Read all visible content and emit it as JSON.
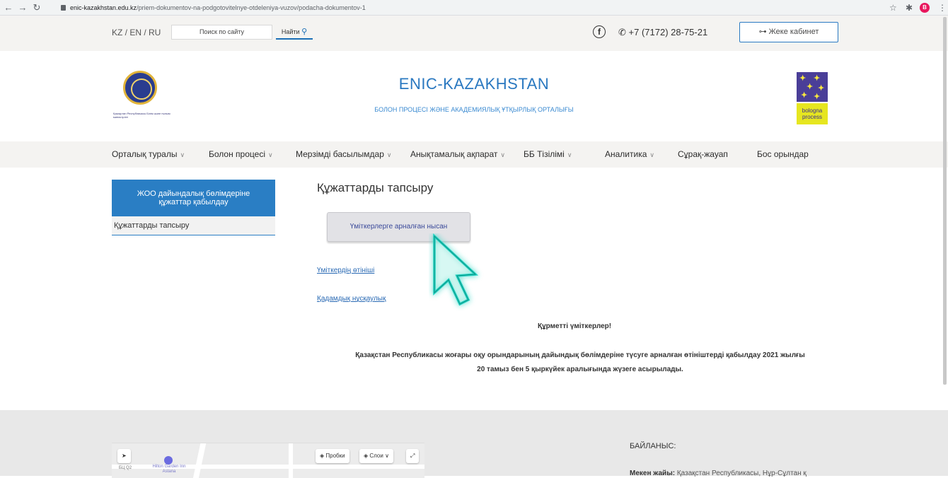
{
  "browser": {
    "url_host": "enic-kazakhstan.edu.kz",
    "url_path": "/priem-dokumentov-na-podgotovitelnye-otdeleniya-vuzov/podacha-dokumentov-1",
    "profile_initial": "B"
  },
  "topbar": {
    "languages": "KZ / EN / RU",
    "search_placeholder": "Поиск по сайту",
    "search_button": "Найти",
    "phone": "+7 (7172) 28-75-21",
    "cabinet_button": "Жеке кабинет"
  },
  "header": {
    "title": "ENIC-KAZAKHSTAN",
    "subtitle": "БОЛОН ПРОЦЕСІ ЖӘНЕ АКАДЕМИЯЛЫҚ ҰТҚЫРЛЫҚ ОРТАЛЫҒЫ",
    "logo_caption": "Қазақстан Республикасы Білім және ғылым министрлігі",
    "bologna_text_1": "bologna",
    "bologna_text_2": "process"
  },
  "nav": {
    "items": [
      {
        "label": "Орталық туралы",
        "dropdown": true
      },
      {
        "label": "Болон процесі",
        "dropdown": true
      },
      {
        "label": "Мерзімді басылымдар",
        "dropdown": true
      },
      {
        "label": "Анықтамалық ақпарат",
        "dropdown": true
      },
      {
        "label": "ББ Тізілімі",
        "dropdown": true
      },
      {
        "label": "Аналитика",
        "dropdown": true
      },
      {
        "label": "Сұрақ-жауап",
        "dropdown": false
      },
      {
        "label": "Бос орындар",
        "dropdown": false
      }
    ]
  },
  "sidebar": {
    "active_section": "ЖОО дайындалық бөлімдеріне құжаттар қабылдау",
    "items": [
      "Құжаттарды тапсыру"
    ]
  },
  "content": {
    "title": "Құжаттарды тапсыру",
    "form_button": "Үміткерлерге арналған нысан",
    "link_application": "Үміткердің өтініші",
    "link_guide": "Қадамдық нұсқаулық",
    "greeting": "Құрметті үміткерлер!",
    "notice_line1": "Қазақстан Республикасы жоғары оқу орындарының дайындық бөлімдеріне түсуге арналған өтініштерді қабылдау 2021 жылғы",
    "notice_line2": "20 тамыз бен 5 қыркүйек аралығында жүзеге асырылады."
  },
  "footer": {
    "contact_title": "БАЙЛАНЫС:",
    "address_label": "Мекен жайы:",
    "address_value": "Қазақстан Республикасы, Нұр-Сұлтан қ",
    "map_label_1": "БЦ Q2",
    "map_poi": "Hilton Garden Inn Astana",
    "map_traffic": "Пробки",
    "map_layers": "Слои"
  },
  "colors": {
    "accent_blue": "#2a7ec4",
    "title_blue": "#2a78c0",
    "bar_bg": "#f4f3f1",
    "cursor_glow": "#23d4c3"
  }
}
